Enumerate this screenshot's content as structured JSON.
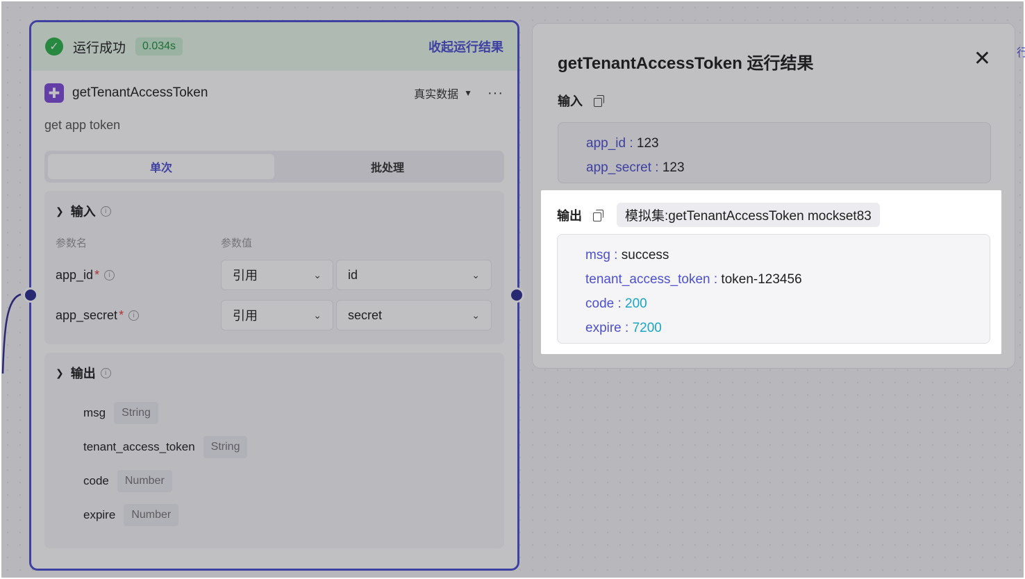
{
  "node": {
    "status_text": "运行成功",
    "duration": "0.034s",
    "collapse_label": "收起运行结果",
    "title": "getTenantAccessToken",
    "data_mode": "真实数据",
    "description": "get app token",
    "tabs": [
      {
        "label": "单次",
        "active": true
      },
      {
        "label": "批处理",
        "active": false
      }
    ],
    "input": {
      "title": "输入",
      "col_name": "参数名",
      "col_value": "参数值",
      "params": [
        {
          "name": "app_id",
          "type": "引用",
          "value": "id"
        },
        {
          "name": "app_secret",
          "type": "引用",
          "value": "secret"
        }
      ]
    },
    "output": {
      "title": "输出",
      "fields": [
        {
          "name": "msg",
          "type": "String"
        },
        {
          "name": "tenant_access_token",
          "type": "String"
        },
        {
          "name": "code",
          "type": "Number"
        },
        {
          "name": "expire",
          "type": "Number"
        }
      ]
    }
  },
  "panel": {
    "title": "getTenantAccessToken 运行结果",
    "input_label": "输入",
    "inputs": [
      {
        "key": "app_id",
        "value": "123"
      },
      {
        "key": "app_secret",
        "value": "123"
      }
    ],
    "output_label": "输出",
    "mockset": "模拟集:getTenantAccessToken mockset83",
    "outputs": [
      {
        "key": "msg",
        "value": "success",
        "numeric": false
      },
      {
        "key": "tenant_access_token",
        "value": "token-123456",
        "numeric": false
      },
      {
        "key": "code",
        "value": "200",
        "numeric": true
      },
      {
        "key": "expire",
        "value": "7200",
        "numeric": true
      }
    ]
  },
  "colors": {
    "accent": "#4d4fd1",
    "success": "#2cb24a",
    "number": "#18a5c7"
  }
}
